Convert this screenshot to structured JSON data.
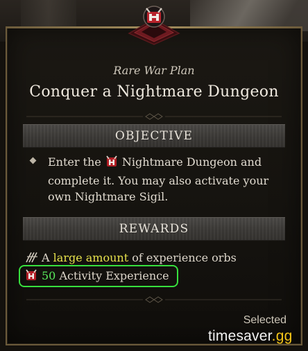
{
  "tooltip": {
    "subtitle": "Rare War Plan",
    "title": "Conquer a Nightmare Dungeon",
    "objective": {
      "header": "OBJECTIVE",
      "text_before_icon": "Enter the",
      "icon": "nightmare-dungeon-icon",
      "text_after_icon": "Nightmare Dungeon and complete it. You may also activate your own Nightmare Sigil."
    },
    "rewards": {
      "header": "REWARDS",
      "items": [
        {
          "icon": "experience-orb-icon",
          "prefix": "A",
          "highlight": "large amount",
          "suffix": "of experience orbs"
        },
        {
          "icon": "activity-experience-icon",
          "amount": "50",
          "label": "Activity Experience"
        }
      ]
    },
    "status": "Selected"
  },
  "watermark": {
    "prefix": "timesaver",
    "accent": ".gg"
  },
  "colors": {
    "frame_gold": "#a58f5e",
    "highlight_yellow": "#e7e24c",
    "highlight_green": "#59ea5c",
    "annotation_green": "#37e03e",
    "emblem_red": "#b8232b"
  }
}
